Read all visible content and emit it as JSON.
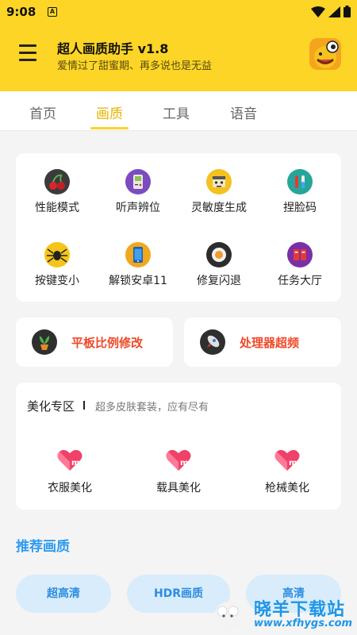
{
  "status_bar": {
    "time": "9:08",
    "a_badge": "A"
  },
  "app": {
    "title": "超人画质助手 v1.8",
    "subtitle": "爱情过了甜蜜期、再多说也是无益"
  },
  "tabs": [
    {
      "label": "首页"
    },
    {
      "label": "画质"
    },
    {
      "label": "工具"
    },
    {
      "label": "语音"
    }
  ],
  "grid": [
    {
      "label": "性能模式",
      "icon": "cherry-icon"
    },
    {
      "label": "听声辨位",
      "icon": "gameboy-icon"
    },
    {
      "label": "灵敏度生成",
      "icon": "robot-face-icon"
    },
    {
      "label": "捏脸码",
      "icon": "test-tubes-icon"
    },
    {
      "label": "按键变小",
      "icon": "spider-icon"
    },
    {
      "label": "解锁安卓11",
      "icon": "phone-icon"
    },
    {
      "label": "修复闪退",
      "icon": "sushi-icon"
    },
    {
      "label": "任务大厅",
      "icon": "list-icon"
    }
  ],
  "action_cards": [
    {
      "label": "平板比例修改",
      "icon": "plant-icon"
    },
    {
      "label": "处理器超频",
      "icon": "rocket-icon"
    }
  ],
  "beauty": {
    "title": "美化专区",
    "subtitle": "超多皮肤套装，应有尽有",
    "items": [
      {
        "label": "衣服美化",
        "icon": "m-heart-icon"
      },
      {
        "label": "载具美化",
        "icon": "m-heart-icon"
      },
      {
        "label": "枪械美化",
        "icon": "m-heart-icon"
      }
    ]
  },
  "recommend": {
    "title": "推荐画质",
    "options": [
      "超高清",
      "HDR画质",
      "高清"
    ]
  },
  "watermark": {
    "text": "晓羊下载站",
    "url": "www.xfhygs.com"
  },
  "colors": {
    "header": "#fcd526",
    "accent_text": "#ef4a2a",
    "recommend": "#2e9bf0",
    "pill_bg": "#d8ecfb"
  }
}
